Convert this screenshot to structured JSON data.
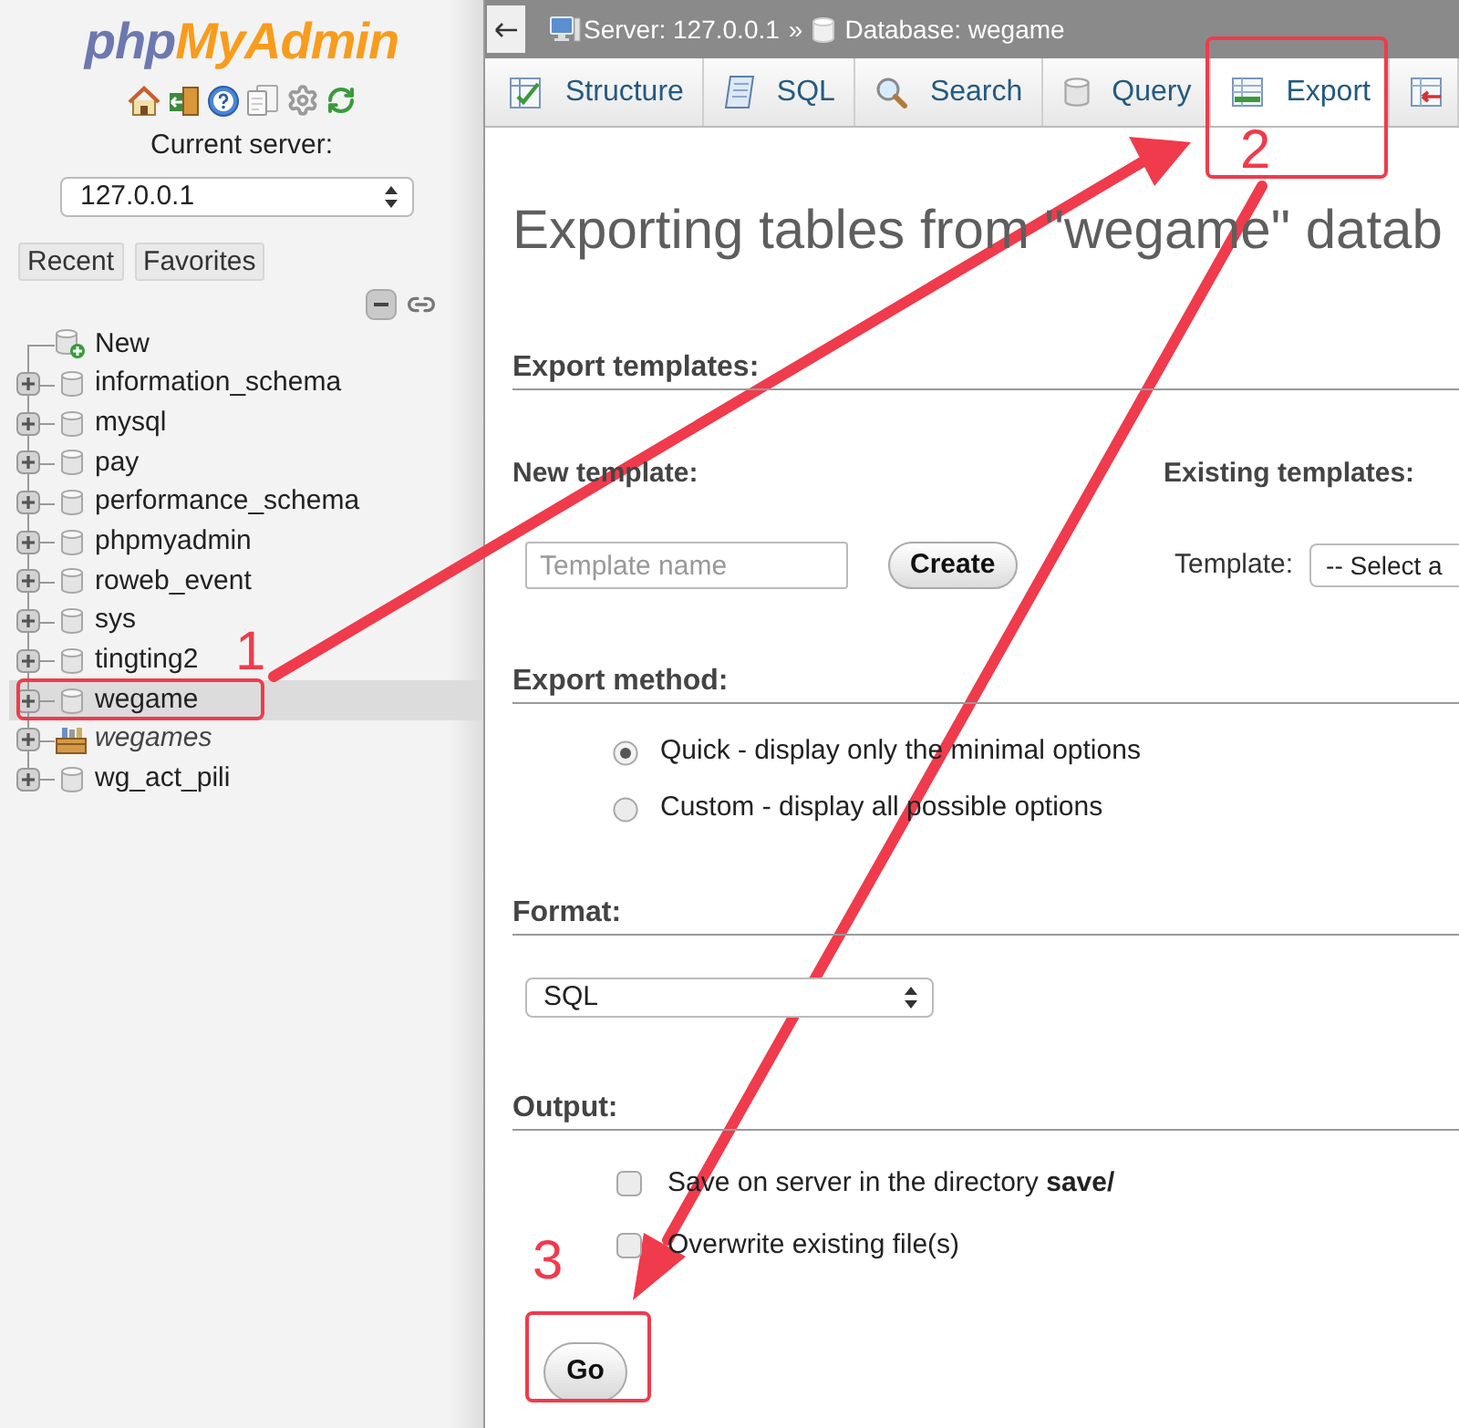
{
  "sidebar": {
    "logo": {
      "text_1": "php",
      "text_2": "MyAdmin"
    },
    "current_server": {
      "label": "Current server:",
      "value": "127.0.0.1"
    },
    "buttons": [
      "Recent",
      "Favorites"
    ],
    "tree": {
      "new": {
        "label": "New"
      },
      "databases": [
        {
          "label": "information_schema",
          "kind": "database",
          "expanded": false,
          "selected": false
        },
        {
          "label": "mysql",
          "kind": "database",
          "expanded": false,
          "selected": false
        },
        {
          "label": "pay",
          "kind": "database",
          "expanded": false,
          "selected": false
        },
        {
          "label": "performance_schema",
          "kind": "database",
          "expanded": false,
          "selected": false
        },
        {
          "label": "phpmyadmin",
          "kind": "database",
          "expanded": false,
          "selected": false
        },
        {
          "label": "roweb_event",
          "kind": "database",
          "expanded": false,
          "selected": false
        },
        {
          "label": "sys",
          "kind": "database",
          "expanded": false,
          "selected": false
        },
        {
          "label": "tingting2",
          "kind": "database",
          "expanded": false,
          "selected": false
        },
        {
          "label": "wegame",
          "kind": "database",
          "expanded": false,
          "selected": true
        },
        {
          "label": "wegames",
          "kind": "special",
          "expanded": false,
          "selected": false
        },
        {
          "label": "wg_act_pili",
          "kind": "database",
          "expanded": false,
          "selected": false
        }
      ]
    }
  },
  "breadcrumb": {
    "items": [
      {
        "label": "Server: 127.0.0.1",
        "kind": "server"
      },
      {
        "label": "Database: wegame",
        "kind": "database"
      }
    ],
    "separator": "»"
  },
  "tabs": [
    {
      "label": "Structure",
      "kind": "structure",
      "selected": false
    },
    {
      "label": "SQL",
      "kind": "sql",
      "selected": false
    },
    {
      "label": "Search",
      "kind": "search",
      "selected": false
    },
    {
      "label": "Query",
      "kind": "query",
      "selected": false
    },
    {
      "label": "Export",
      "kind": "export",
      "selected": true
    },
    {
      "kind": "import",
      "selected": false
    }
  ],
  "title": "Exporting tables from \"wegame\" datab",
  "export_templates": {
    "heading": "Export templates:",
    "new_template": {
      "label": "New template:",
      "placeholder": "Template name",
      "button": "Create"
    },
    "existing_templates": {
      "label": "Existing templates:",
      "field_label": "Template:",
      "value": "-- Select a"
    }
  },
  "export_method": {
    "heading": "Export method:",
    "options": [
      {
        "label": "Quick - display only the minimal options",
        "selected": true
      },
      {
        "label": "Custom - display all possible options",
        "selected": false
      }
    ]
  },
  "format": {
    "heading": "Format:",
    "value": "SQL"
  },
  "output": {
    "heading": "Output:",
    "options": [
      {
        "label": "Save on server in the directory **save/**",
        "checked": false
      },
      {
        "label": "Overwrite existing file(s)",
        "checked": false
      }
    ]
  },
  "go_button": "Go",
  "annotations": [
    {
      "label": "1"
    },
    {
      "label": "2"
    },
    {
      "label": "3"
    }
  ]
}
